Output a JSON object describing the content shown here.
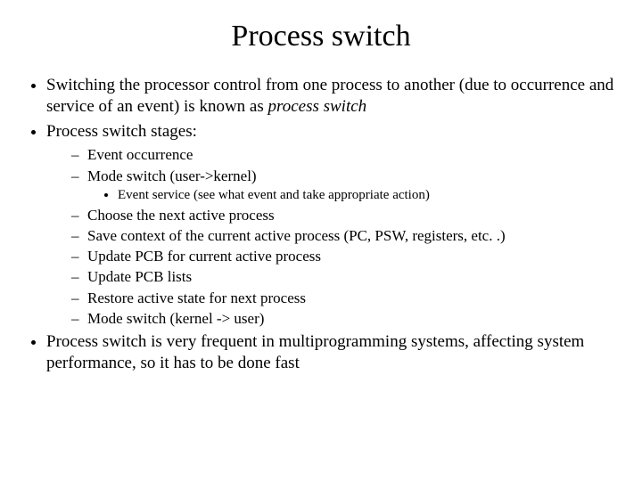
{
  "title": "Process switch",
  "bullets": {
    "b1_pre": "Switching the processor control from one process to another (due to occurrence and service of an event) is known as ",
    "b1_em": "process switch",
    "b2": "Process switch stages:",
    "s1": "Event occurrence",
    "s2": "Mode switch (user->kernel)",
    "s2a": "Event service (see what event and take appropriate action)",
    "s3": "Choose the next active process",
    "s4": "Save context of the current active process (PC, PSW, registers, etc. .)",
    "s5": "Update PCB for current active process",
    "s6": "Update PCB lists",
    "s7": "Restore active state for next process",
    "s8": "Mode switch (kernel -> user)",
    "b3": "Process switch is very frequent in multiprogramming systems, affecting system performance, so it has to be done fast"
  }
}
